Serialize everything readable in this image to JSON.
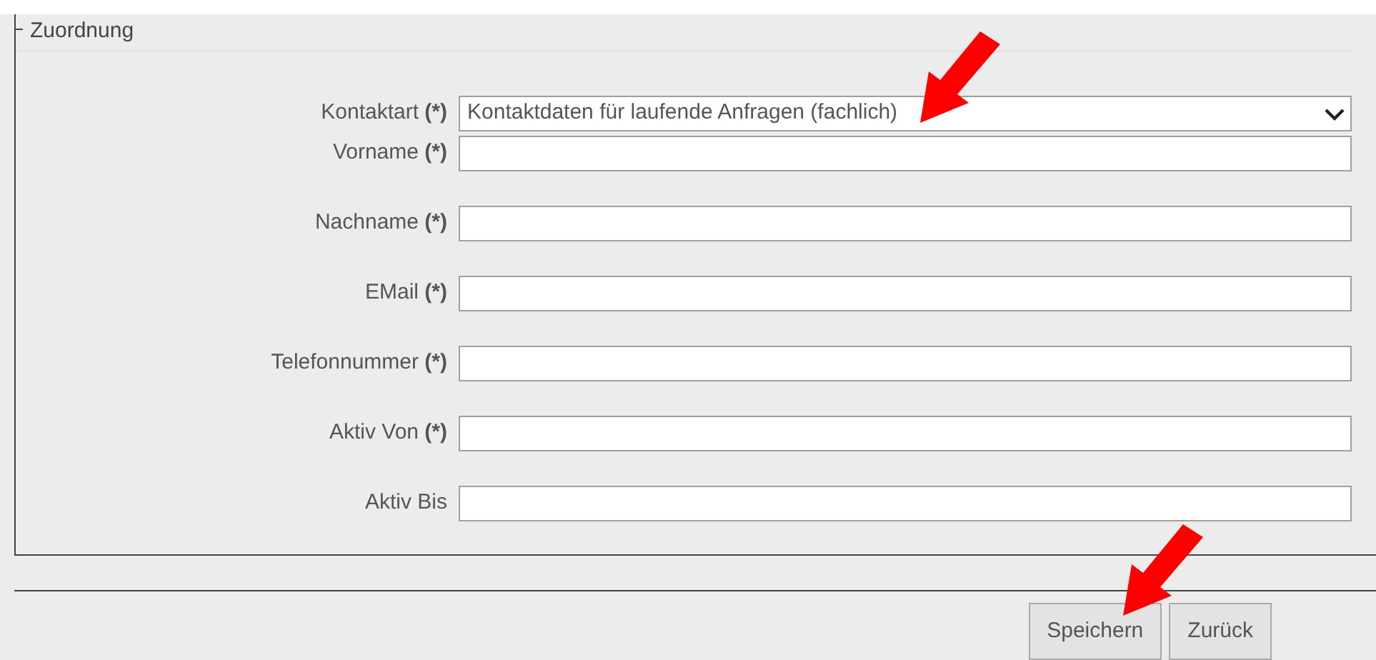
{
  "fieldset": {
    "legend": "Zuordnung"
  },
  "fields": [
    {
      "kind": "select",
      "label": "Kontaktart **(*)**",
      "value": "Kontaktdaten für laufende Anfragen (fachlich)"
    },
    {
      "kind": "text",
      "label": "Vorname **(*)**"
    },
    {
      "kind": "text",
      "label": "Nachname **(*)**"
    },
    {
      "kind": "text",
      "label": "EMail **(*)**"
    },
    {
      "kind": "text",
      "label": "Telefonnummer **(*)**"
    },
    {
      "kind": "text",
      "label": "Aktiv Von **(*)**"
    },
    {
      "kind": "text",
      "label": "Aktiv Bis"
    }
  ],
  "buttons": [
    "Speichern",
    "Zurück"
  ]
}
